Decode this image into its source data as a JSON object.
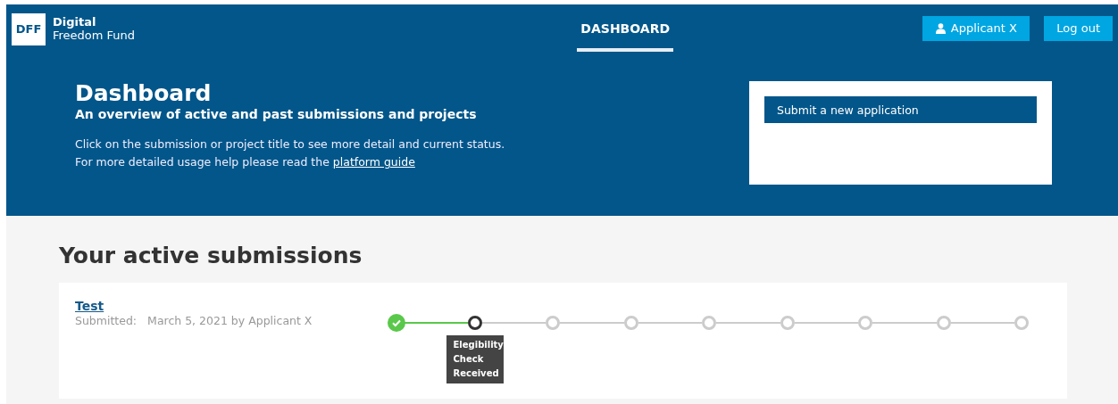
{
  "header": {
    "logo": "DFF",
    "brand_line1": "Digital",
    "brand_line2": "Freedom Fund",
    "nav": [
      {
        "label": "DASHBOARD",
        "selected": true
      }
    ],
    "user_button": "Applicant X",
    "logout_button": "Log out"
  },
  "hero": {
    "title": "Dashboard",
    "subtitle": "An overview of active and past submissions and projects",
    "help_line1": "Click on the submission or project title to see more detail and current status.",
    "help_line2": "For more detailed usage help please read the ",
    "help_link": "platform guide",
    "action_button": "Submit a new application"
  },
  "active": {
    "heading": "Your active submissions",
    "submissions": [
      {
        "title": "Test",
        "submitted_label": "Submitted:",
        "submitted_value": "March 5, 2021 by Applicant X",
        "steps": [
          {
            "completed": true,
            "current": false
          },
          {
            "completed": false,
            "current": true,
            "tooltip": "Elegibility Check Received"
          },
          {
            "completed": false,
            "current": false
          },
          {
            "completed": false,
            "current": false
          },
          {
            "completed": false,
            "current": false
          },
          {
            "completed": false,
            "current": false
          },
          {
            "completed": false,
            "current": false
          },
          {
            "completed": false,
            "current": false
          },
          {
            "completed": false,
            "current": false
          }
        ]
      }
    ]
  }
}
